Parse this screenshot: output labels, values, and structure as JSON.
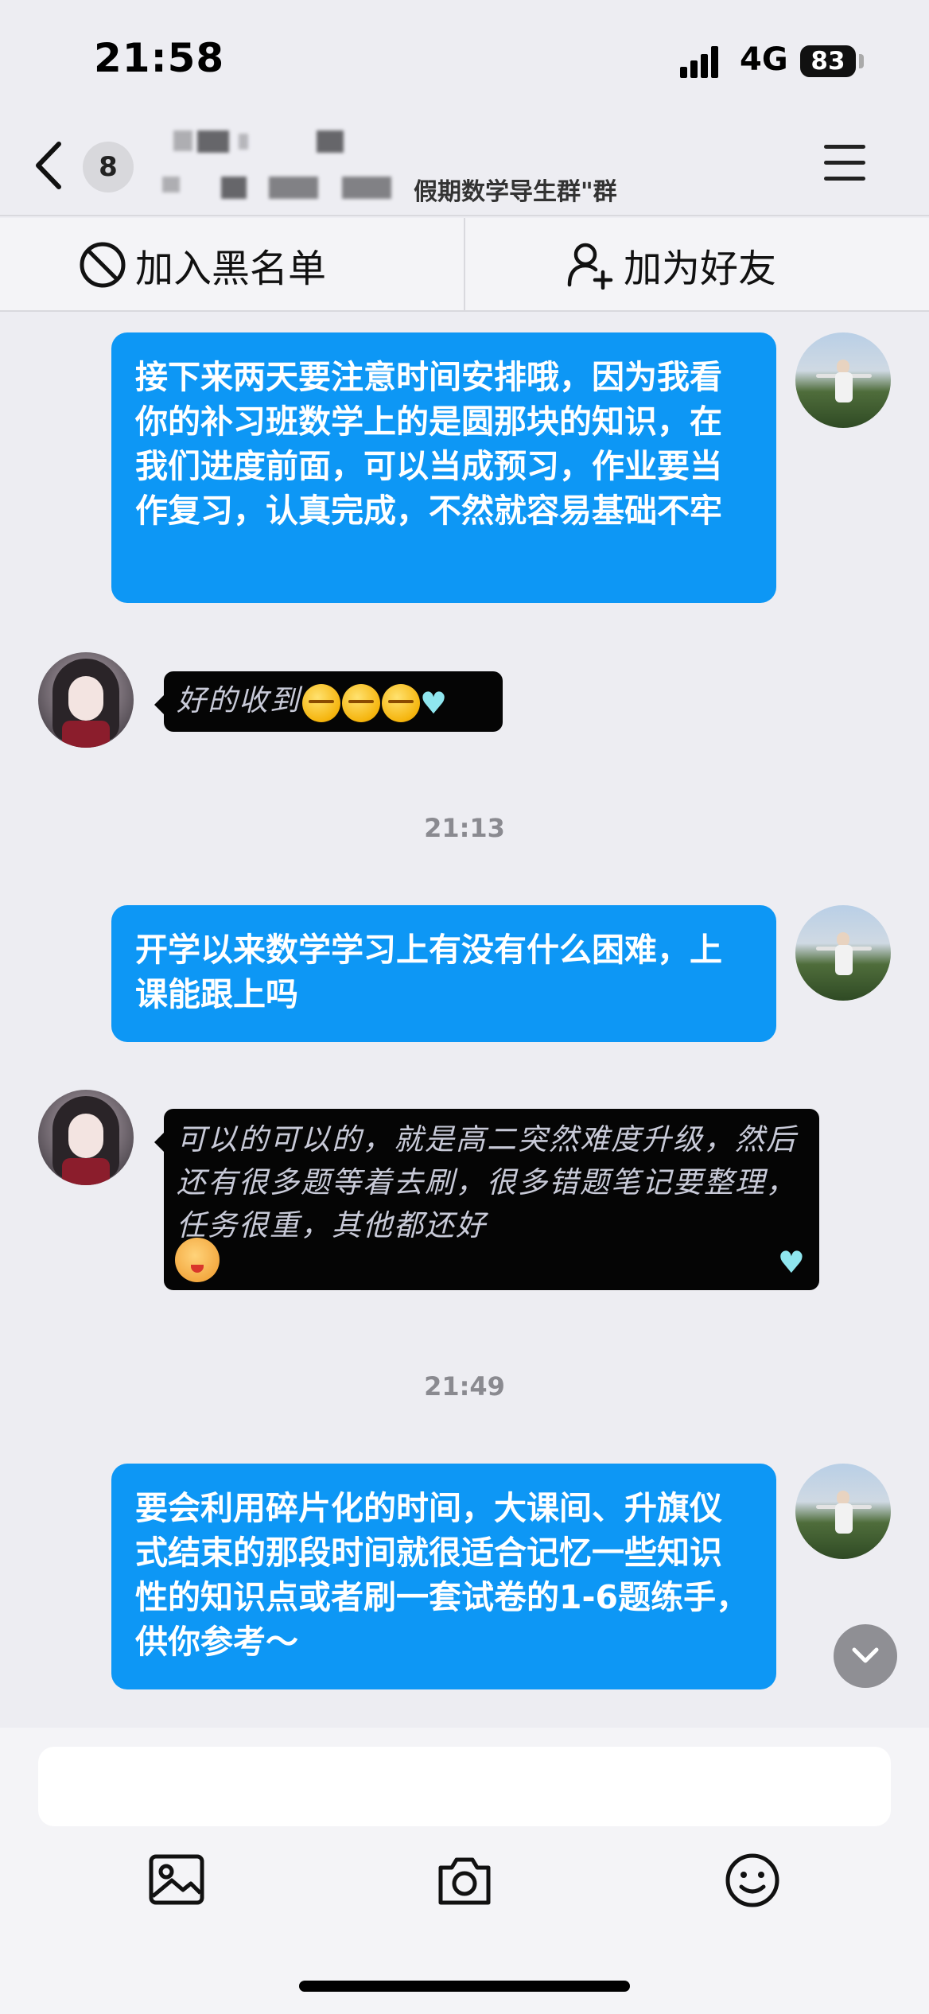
{
  "status_bar": {
    "time": "21:58",
    "network": "4G",
    "battery": "83"
  },
  "header": {
    "unread_count": "8",
    "subtitle_visible": "假期数学导生群\"群"
  },
  "actions": {
    "blacklist_label": "加入黑名单",
    "add_friend_label": "加为好友"
  },
  "messages": [
    {
      "sender": "self",
      "text": "接下来两天要注意时间安排哦，因为我看你的补习班数学上的是圆那块的知识，在我们进度前面，可以当成预习，作业要当作复习，认真完成，不然就容易基础不牢"
    },
    {
      "sender": "other",
      "text": "好的收到"
    },
    {
      "sender": "timestamp",
      "text": "21:13"
    },
    {
      "sender": "self",
      "text": "开学以来数学学习上有没有什么困难，上课能跟上吗"
    },
    {
      "sender": "other",
      "text": "可以的可以的，就是高二突然难度升级，然后还有很多题等着去刷，很多错题笔记要整理，任务很重，其他都还好"
    },
    {
      "sender": "timestamp",
      "text": "21:49"
    },
    {
      "sender": "self",
      "text": "要会利用碎片化的时间，大课间、升旗仪式结束的那段时间就很适合记忆一些知识性的知识点或者刷一套试卷的1-6题练手，供你参考～"
    }
  ],
  "input": {
    "placeholder": ""
  },
  "toolbar": {
    "icons": [
      "image-icon",
      "camera-icon",
      "emoji-icon"
    ]
  },
  "colors": {
    "self_bubble": "#0d97f5",
    "other_bubble": "#050505",
    "background": "#ededf2"
  }
}
